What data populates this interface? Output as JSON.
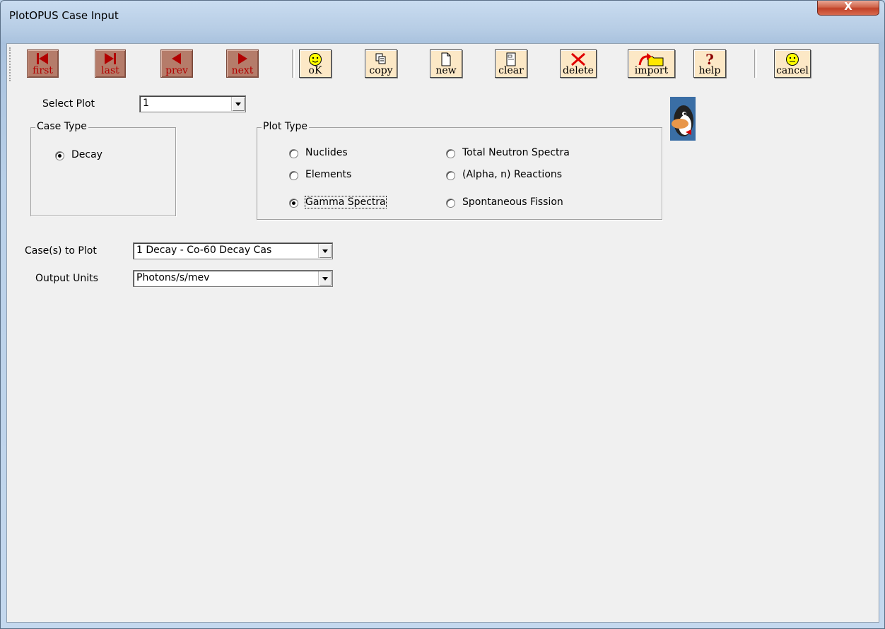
{
  "window": {
    "title": "PlotOPUS Case Input",
    "close_label": "X"
  },
  "toolbar": {
    "first": "first",
    "last": "last",
    "prev": "prev",
    "next": "next",
    "ok": "oK",
    "copy": "copy",
    "new": "new",
    "clear": "clear",
    "delete": "delete",
    "import": "import",
    "help": "help",
    "cancel": "cancel"
  },
  "select_plot": {
    "label": "Select Plot",
    "value": "1"
  },
  "case_type": {
    "legend": "Case Type",
    "options": [
      {
        "label": "Decay",
        "selected": true
      }
    ]
  },
  "plot_type": {
    "legend": "Plot Type",
    "options": [
      {
        "label": "Nuclides",
        "selected": false
      },
      {
        "label": "Elements",
        "selected": false
      },
      {
        "label": "Gamma Spectra",
        "selected": true
      },
      {
        "label": "Total Neutron Spectra",
        "selected": false
      },
      {
        "label": "(Alpha, n)  Reactions",
        "selected": false
      },
      {
        "label": "Spontaneous Fission",
        "selected": false
      }
    ]
  },
  "cases_to_plot": {
    "label": "Case(s) to Plot",
    "value": "1 Decay - Co-60 Decay Cas"
  },
  "output_units": {
    "label": "Output Units",
    "value": "Photons/s/mev"
  },
  "colors": {
    "accent_nav": "#b57c6a",
    "nav_text": "#b20000",
    "action_bg": "#fce8c6"
  }
}
